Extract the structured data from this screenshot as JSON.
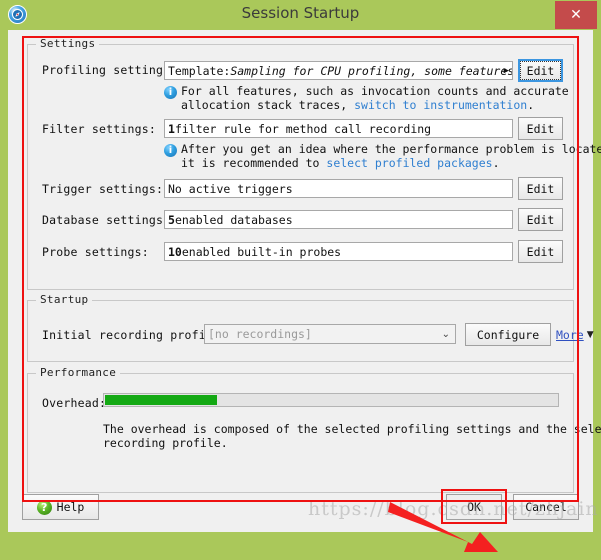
{
  "window": {
    "title": "Session Startup",
    "app_icon": "compass-icon",
    "close_label": "✕",
    "titlebar_color": "#aac85a",
    "close_color": "#c44b4b"
  },
  "settings_group": {
    "legend": "Settings",
    "rows": [
      {
        "label": "Profiling settings:",
        "value_prefix": "Template: ",
        "value_italic": "Sampling for CPU profiling, some features not s",
        "overflow_arrow": "▶",
        "button": "Edit",
        "focused": true
      },
      {
        "label": "Filter settings:",
        "value_bold": "1",
        "value_rest": " filter rule for method call recording",
        "button": "Edit",
        "focused": false
      },
      {
        "label": "Trigger settings:",
        "value_rest": "No active triggers",
        "button": "Edit",
        "focused": false
      },
      {
        "label": "Database settings:",
        "value_bold": "5",
        "value_rest": " enabled databases",
        "button": "Edit",
        "focused": false
      },
      {
        "label": "Probe settings:",
        "value_bold": "10",
        "value_rest": " enabled built-in probes",
        "button": "Edit",
        "focused": false
      }
    ],
    "note_profiling": {
      "icon": "info-icon",
      "line1": "For all features, such as invocation counts and accurate",
      "line2_pre": "allocation stack traces, ",
      "line2_link": "switch to instrumentation",
      "line2_post": "."
    },
    "note_filter": {
      "icon": "info-icon",
      "line1": "After you get an idea where the performance problem is located,",
      "line2_pre": "it is recommended to ",
      "line2_link": "select profiled packages",
      "line2_post": "."
    }
  },
  "startup_group": {
    "legend": "Startup",
    "label": "Initial recording profile:",
    "combo_value": "[no recordings]",
    "combo_arrow": "⌄",
    "configure_button": "Configure",
    "more_link": "More",
    "more_arrow": "▼"
  },
  "performance_group": {
    "legend": "Performance",
    "overhead_label": "Overhead:",
    "overhead_percent": 25,
    "overhead_color": "#14a914",
    "description_line1": "The overhead is composed of the selected profiling settings and the selected",
    "description_line2": "recording profile."
  },
  "bottom_bar": {
    "help_label": "Help",
    "help_icon": "question-mark-icon",
    "ok_label": "OK",
    "cancel_label": "Cancel"
  },
  "annotations": {
    "watermark": "https://blog.csdn.net/zhjain",
    "highlight_color": "#ee1111",
    "arrow_color": "#f42020"
  }
}
